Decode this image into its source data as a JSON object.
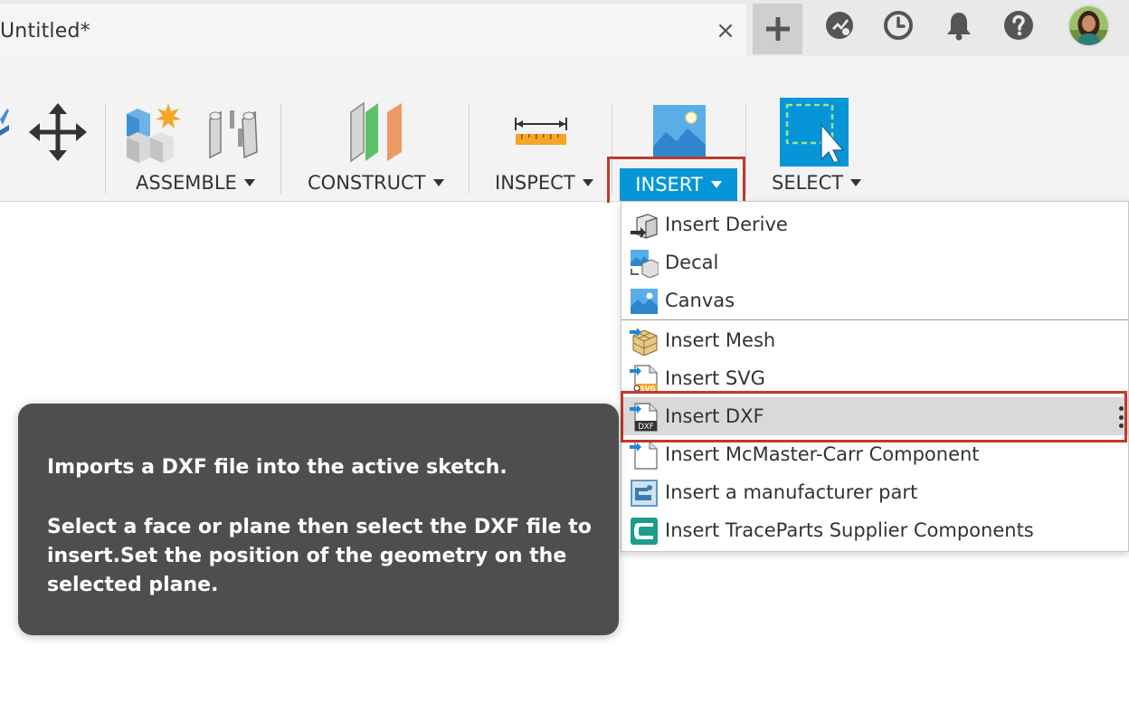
{
  "titlebar": {
    "doc_title": "Untitled*",
    "close_symbol": "×",
    "icons": [
      "plus-icon",
      "extensions-icon",
      "clock-icon",
      "bell-icon",
      "help-icon",
      "avatar"
    ]
  },
  "toolbar": {
    "groups": {
      "assemble": "ASSEMBLE",
      "construct": "CONSTRUCT",
      "inspect": "INSPECT",
      "insert": "INSERT",
      "select": "SELECT"
    }
  },
  "insert_menu": {
    "items": [
      {
        "label": "Insert Derive",
        "icon": "insert-derive-icon"
      },
      {
        "label": "Decal",
        "icon": "decal-icon"
      },
      {
        "label": "Canvas",
        "icon": "canvas-icon"
      },
      {
        "label": "Insert Mesh",
        "icon": "insert-mesh-icon"
      },
      {
        "label": "Insert SVG",
        "icon": "insert-svg-icon"
      },
      {
        "label": "Insert DXF",
        "icon": "insert-dxf-icon"
      },
      {
        "label": "Insert McMaster-Carr Component",
        "icon": "mcmaster-icon"
      },
      {
        "label": "Insert a manufacturer part",
        "icon": "manufacturer-part-icon"
      },
      {
        "label": "Insert TraceParts Supplier Components",
        "icon": "traceparts-icon"
      }
    ],
    "highlighted": "Insert DXF",
    "icon_text": {
      "svg": "SVG",
      "dxf": "DXF"
    }
  },
  "tooltip": {
    "line1": "Imports a DXF file into the active sketch.",
    "line2": "Select a face or plane then select the DXF file to insert.Set the position of the geometry on the selected plane."
  },
  "colors": {
    "accent": "#0696d7",
    "highlight_frame": "#c0392b",
    "tooltip_bg": "#4e4e4e",
    "menu_highlight": "#d9d9d9"
  }
}
